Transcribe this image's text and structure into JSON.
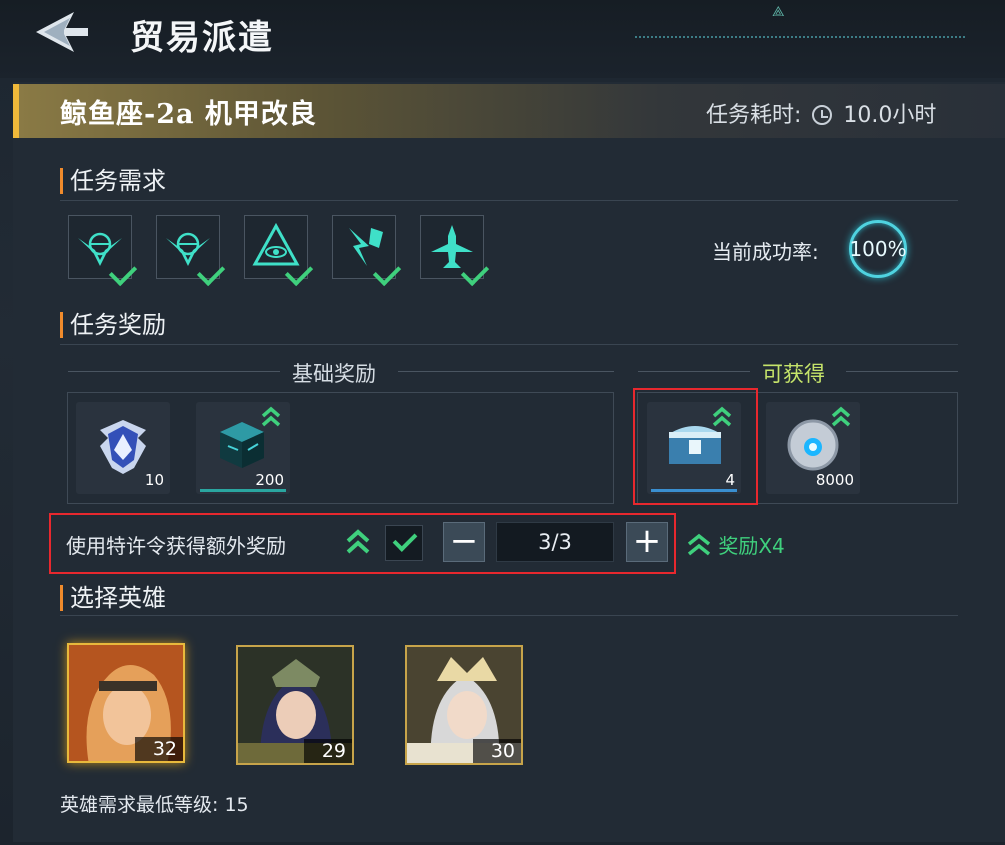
{
  "header": {
    "title": "贸易派遣"
  },
  "mission": {
    "name": "鲸鱼座-2a 机甲改良",
    "time_label": "任务耗时:",
    "time_value": "10.0小时"
  },
  "requirements": {
    "title": "任务需求",
    "icons": [
      "globe-wings-icon",
      "globe-wings-icon",
      "eye-triangle-icon",
      "lightning-shield-icon",
      "jet-icon"
    ],
    "success_label": "当前成功率:",
    "success_value": "100%"
  },
  "rewards": {
    "title": "任务奖励",
    "basic_label": "基础奖励",
    "available_label": "可获得",
    "basic_items": [
      {
        "icon": "rank-badge-icon",
        "qty": "10"
      },
      {
        "icon": "data-cube-icon",
        "qty": "200"
      }
    ],
    "available_items": [
      {
        "icon": "treasure-chest-icon",
        "qty": "4"
      },
      {
        "icon": "energy-orb-icon",
        "qty": "8000"
      }
    ]
  },
  "permit": {
    "label": "使用特许令获得额外奖励",
    "minus": "−",
    "value": "3/3",
    "plus": "+",
    "bonus": "奖励X4"
  },
  "heroes": {
    "title": "选择英雄",
    "list": [
      {
        "level": "32",
        "selected": true
      },
      {
        "level": "29",
        "selected": false
      },
      {
        "level": "30",
        "selected": false
      }
    ],
    "min_level_label": "英雄需求最低等级:",
    "min_level_value": "15"
  },
  "colors": {
    "accent_green": "#3fd07d",
    "accent_orange": "#f08b2c",
    "highlight_red": "#e8282e",
    "gold": "#f0b93a"
  }
}
